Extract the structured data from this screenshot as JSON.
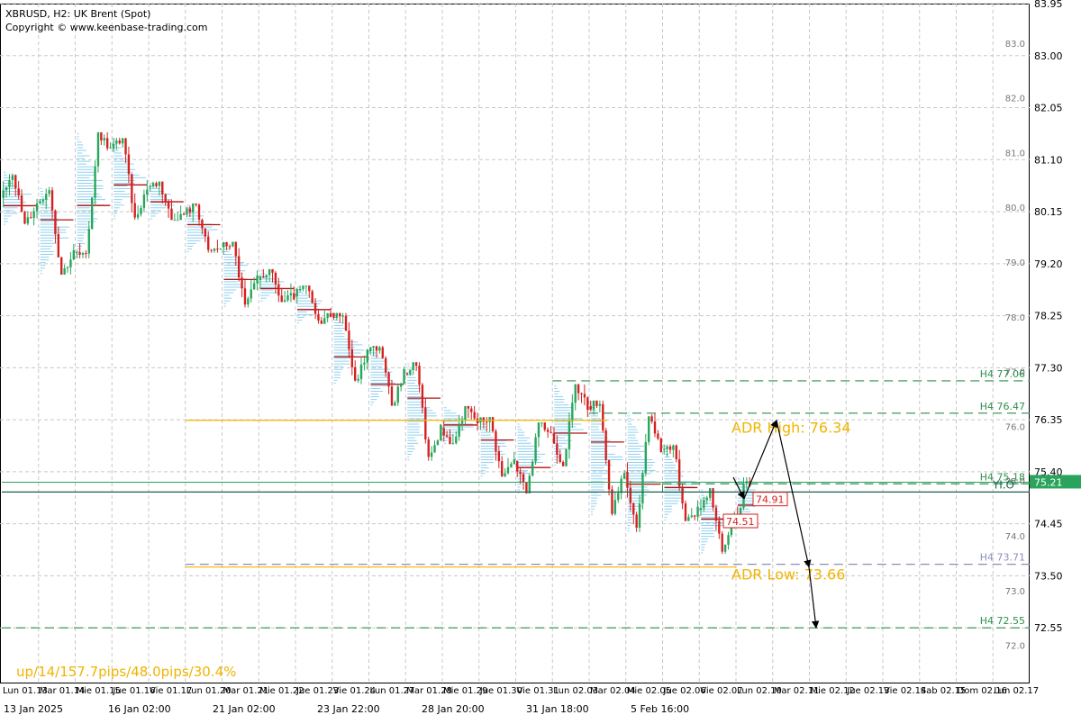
{
  "header": {
    "symbol_line": "XBRUSD, H2:  UK Brent (Spot)",
    "copyright": "Copyright © www.keenbase-trading.com"
  },
  "stats_text": "up/14/157.7pips/48.0pips/30.4%",
  "colors": {
    "up_candle": "#26a65b",
    "down_candle": "#d62020",
    "profile": "#8fd0ee",
    "grid": "#c8c8c8",
    "h4_level": "#2f8f4f",
    "adr": "#f0b400",
    "low_level": "#8c8fb8",
    "yio": "#1f5f4f",
    "price_tag": "#2aa45c",
    "callout": "#d62020",
    "poc": "#b51010"
  },
  "chart_data": {
    "type": "candlestick",
    "symbol": "XBRUSD",
    "timeframe": "H2",
    "ylim": [
      71.55,
      83.95
    ],
    "y_ticks_major": [
      "83.95",
      "83.00",
      "82.05",
      "81.10",
      "80.15",
      "79.20",
      "78.25",
      "77.30",
      "76.35",
      "75.40",
      "74.45",
      "73.50",
      "72.55"
    ],
    "y_ticks_minor": [
      "83.0",
      "82.0",
      "81.0",
      "80.0",
      "79.0",
      "78.0",
      "77.0",
      "76.0",
      "75.0",
      "74.0",
      "73.0",
      "72.0"
    ],
    "x_dates": [
      "13 Jan 2025",
      "16 Jan 02:00",
      "21 Jan 02:00",
      "23 Jan 22:00",
      "28 Jan 20:00",
      "31 Jan 18:00",
      "5 Feb 16:00"
    ],
    "x_day_labels": [
      "Lun 01.13",
      "Mar 01.14",
      "Mie 01.15",
      "Jue 01.16",
      "Vie 01.17",
      "Lun 01.20",
      "Mar 01.21",
      "Mie 01.22",
      "Jue 01.23",
      "Vie 01.24",
      "Lun 01.27",
      "Mar 01.28",
      "Mie 01.29",
      "Jue 01.30",
      "Vie 01.31",
      "Lun 02.03",
      "Mar 02.04",
      "Mie 02.05",
      "Jue 02.06",
      "Vie 02.07",
      "Lun 02.10",
      "Mar 02.11",
      "Mie 02.12",
      "Jue 02.13",
      "Vie 02.14",
      "Sab 02.15",
      "Dom 02.16",
      "Lun 02.17"
    ],
    "current_price": "75.21",
    "levels": [
      {
        "label": "H4 77.06",
        "value": 77.06,
        "kind": "h4"
      },
      {
        "label": "H4 76.47",
        "value": 76.47,
        "kind": "h4"
      },
      {
        "label": "H4 75.18",
        "value": 75.18,
        "kind": "h4"
      },
      {
        "label": "H4 73.71",
        "value": 73.71,
        "kind": "low"
      },
      {
        "label": "H4 72.55",
        "value": 72.55,
        "kind": "h4"
      }
    ],
    "adr": {
      "high_label": "ADR High: 76.34",
      "high": 76.34,
      "low_label": "ADR Low: 73.66",
      "low": 73.66
    },
    "yio": {
      "label": "YI.O",
      "value": 75.03
    },
    "callouts": [
      {
        "label": "74.91",
        "value": 74.91
      },
      {
        "label": "74.51",
        "value": 74.51
      }
    ],
    "daily_candles": [
      {
        "day": "Lun 01.13",
        "o": 80.4,
        "h": 80.9,
        "l": 79.9,
        "c": 80.3
      },
      {
        "day": "Mar 01.14",
        "o": 80.3,
        "h": 80.6,
        "l": 79.0,
        "c": 79.4
      },
      {
        "day": "Mie 01.15",
        "o": 79.4,
        "h": 81.6,
        "l": 79.3,
        "c": 81.3
      },
      {
        "day": "Jue 01.16",
        "o": 81.3,
        "h": 81.5,
        "l": 80.0,
        "c": 80.6
      },
      {
        "day": "Vie 01.17",
        "o": 80.6,
        "h": 80.7,
        "l": 80.0,
        "c": 80.1
      },
      {
        "day": "Lun 01.20",
        "o": 80.1,
        "h": 80.3,
        "l": 79.4,
        "c": 79.5
      },
      {
        "day": "Mar 01.21",
        "o": 79.5,
        "h": 79.6,
        "l": 78.4,
        "c": 78.9
      },
      {
        "day": "Mie 01.22",
        "o": 78.9,
        "h": 79.1,
        "l": 78.5,
        "c": 78.6
      },
      {
        "day": "Jue 01.23",
        "o": 78.6,
        "h": 78.8,
        "l": 78.1,
        "c": 78.3
      },
      {
        "day": "Vie 01.24",
        "o": 78.3,
        "h": 78.3,
        "l": 77.0,
        "c": 77.6
      },
      {
        "day": "Lun 01.27",
        "o": 77.6,
        "h": 77.7,
        "l": 76.6,
        "c": 77.2
      },
      {
        "day": "Mar 01.28",
        "o": 77.2,
        "h": 77.4,
        "l": 75.6,
        "c": 76.2
      },
      {
        "day": "Mie 01.29",
        "o": 76.2,
        "h": 76.6,
        "l": 75.9,
        "c": 76.3
      },
      {
        "day": "Jue 01.30",
        "o": 76.3,
        "h": 76.4,
        "l": 75.3,
        "c": 75.6
      },
      {
        "day": "Vie 01.31",
        "o": 75.6,
        "h": 76.3,
        "l": 75.0,
        "c": 76.1
      },
      {
        "day": "Lun 02.03",
        "o": 76.1,
        "h": 77.0,
        "l": 75.5,
        "c": 76.6
      },
      {
        "day": "Mar 02.04",
        "o": 76.6,
        "h": 76.7,
        "l": 74.6,
        "c": 75.4
      },
      {
        "day": "Mie 02.05",
        "o": 75.4,
        "h": 76.5,
        "l": 74.3,
        "c": 75.8
      },
      {
        "day": "Jue 02.06",
        "o": 75.8,
        "h": 75.9,
        "l": 74.5,
        "c": 74.7
      },
      {
        "day": "Vie 02.07",
        "o": 74.7,
        "h": 75.1,
        "l": 73.9,
        "c": 74.6
      },
      {
        "day": "Lun 02.10",
        "o": 74.6,
        "h": 75.3,
        "l": 74.5,
        "c": 75.2
      }
    ],
    "projection": {
      "start": 75.3,
      "dip": 74.91,
      "high": 76.34,
      "mid": 73.66,
      "target": 72.55
    }
  }
}
